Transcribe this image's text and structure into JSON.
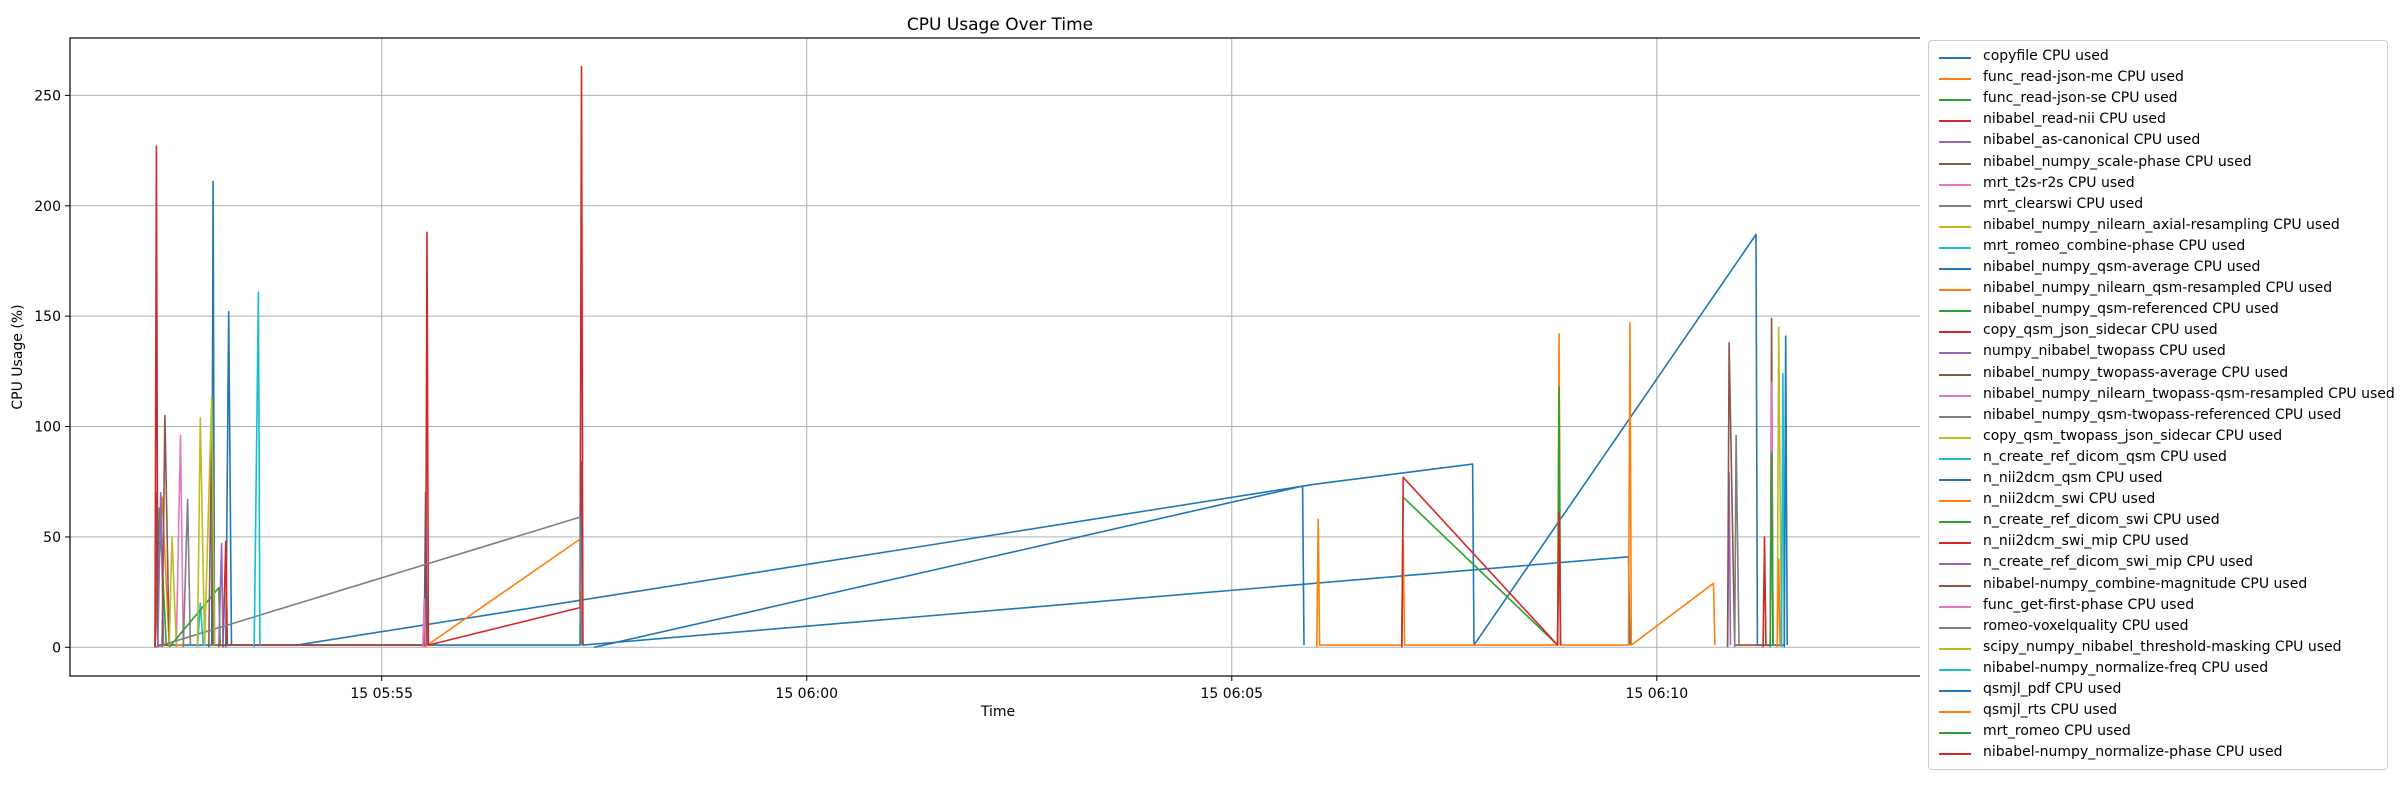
{
  "palette": [
    "#1f77b4",
    "#ff7f0e",
    "#2ca02c",
    "#d62728",
    "#9467bd",
    "#8c564b",
    "#e377c2",
    "#7f7f7f",
    "#bcbd22",
    "#17becf"
  ],
  "chart_data": {
    "type": "line",
    "title": "CPU Usage Over Time",
    "xlabel": "Time",
    "ylabel": "CPU Usage (%)",
    "xlim": [
      "05:51:20",
      "06:13:10"
    ],
    "ylim": [
      -13,
      276
    ],
    "x_ticks": [
      "15 05:55",
      "15 06:00",
      "15 06:05",
      "15 06:10"
    ],
    "y_ticks": [
      "0",
      "50",
      "100",
      "150",
      "200",
      "250"
    ],
    "grid": true,
    "legend_position": "outside-right",
    "series": [
      {
        "name": "copyfile CPU used",
        "points": [
          [
            "05:52:20",
            0
          ],
          [
            "05:52:21",
            70
          ],
          [
            "05:52:22",
            1
          ],
          [
            "05:53:00",
            1
          ],
          [
            "05:53:01",
            211
          ],
          [
            "05:53:02",
            1
          ],
          [
            "05:54:00",
            1
          ],
          [
            "06:06:00",
            74
          ],
          [
            "06:07:50",
            83
          ],
          [
            "06:07:51",
            1
          ],
          [
            "06:11:10",
            187
          ],
          [
            "06:11:11",
            1
          ],
          [
            "06:11:30",
            1
          ]
        ]
      },
      {
        "name": "func_read-json-me CPU used",
        "points": [
          [
            "05:52:20",
            0
          ],
          [
            "05:52:25",
            68
          ],
          [
            "05:52:30",
            1
          ],
          [
            "05:52:40",
            1
          ]
        ]
      },
      {
        "name": "func_read-json-se CPU used",
        "points": [
          [
            "05:52:20",
            0
          ],
          [
            "05:52:23",
            63
          ],
          [
            "05:52:28",
            1
          ],
          [
            "05:52:35",
            1
          ]
        ]
      },
      {
        "name": "nibabel_read-nii CPU used",
        "points": [
          [
            "05:52:20",
            0
          ],
          [
            "05:52:21",
            227
          ],
          [
            "05:52:22",
            1
          ],
          [
            "05:52:30",
            1
          ]
        ]
      },
      {
        "name": "nibabel_as-canonical CPU used",
        "points": [
          [
            "05:52:22",
            0
          ],
          [
            "05:52:24",
            70
          ],
          [
            "05:52:26",
            1
          ]
        ]
      },
      {
        "name": "nibabel_numpy_scale-phase CPU used",
        "points": [
          [
            "05:52:25",
            0
          ],
          [
            "05:52:27",
            105
          ],
          [
            "05:52:30",
            1
          ]
        ]
      },
      {
        "name": "mrt_t2s-r2s CPU used",
        "points": [
          [
            "05:52:35",
            0
          ],
          [
            "05:52:38",
            96
          ],
          [
            "05:52:40",
            1
          ]
        ]
      },
      {
        "name": "mrt_clearswi CPU used",
        "points": [
          [
            "05:52:40",
            0
          ],
          [
            "05:52:43",
            67
          ],
          [
            "05:52:45",
            1
          ]
        ]
      },
      {
        "name": "nibabel_numpy_nilearn_axial-resampling CPU used",
        "points": [
          [
            "05:52:30",
            0
          ],
          [
            "05:52:32",
            50
          ],
          [
            "05:52:35",
            1
          ]
        ]
      },
      {
        "name": "mrt_romeo_combine-phase CPU used",
        "points": [
          [
            "05:52:50",
            0
          ],
          [
            "05:52:52",
            20
          ],
          [
            "05:52:54",
            1
          ]
        ]
      },
      {
        "name": "nibabel_numpy_qsm-average CPU used",
        "points": [
          [
            "05:53:10",
            0
          ],
          [
            "05:53:12",
            152
          ],
          [
            "05:53:14",
            1
          ],
          [
            "05:55:30",
            1
          ],
          [
            "05:55:31",
            70
          ],
          [
            "05:55:32",
            1
          ],
          [
            "05:57:20",
            1
          ],
          [
            "05:57:21",
            84
          ],
          [
            "05:57:22",
            1
          ],
          [
            "06:09:40",
            41
          ],
          [
            "06:09:41",
            1
          ]
        ]
      },
      {
        "name": "nibabel_numpy_nilearn_qsm-resampled CPU used",
        "points": [
          [
            "05:55:30",
            0
          ],
          [
            "05:57:20",
            49
          ],
          [
            "05:57:21",
            1
          ]
        ]
      },
      {
        "name": "nibabel_numpy_qsm-referenced CPU used",
        "points": [
          [
            "05:52:30",
            0
          ],
          [
            "05:53:05",
            27
          ],
          [
            "05:53:06",
            1
          ]
        ]
      },
      {
        "name": "copy_qsm_json_sidecar CPU used",
        "points": [
          [
            "05:53:08",
            0
          ],
          [
            "05:53:10",
            48
          ],
          [
            "05:53:11",
            1
          ],
          [
            "05:55:31",
            1
          ],
          [
            "05:55:32",
            188
          ],
          [
            "05:55:33",
            1
          ],
          [
            "05:57:20",
            18
          ],
          [
            "05:57:21",
            263
          ],
          [
            "05:57:22",
            1
          ]
        ]
      },
      {
        "name": "numpy_nibabel_twopass CPU used",
        "points": [
          [
            "05:53:05",
            0
          ],
          [
            "05:53:07",
            47
          ],
          [
            "05:53:08",
            1
          ]
        ]
      },
      {
        "name": "nibabel_numpy_twopass-average CPU used",
        "points": [
          [
            "05:52:58",
            0
          ],
          [
            "05:53:00",
            102
          ],
          [
            "05:53:01",
            1
          ],
          [
            "05:55:30",
            1
          ],
          [
            "05:55:31",
            24
          ],
          [
            "05:55:32",
            1
          ]
        ]
      },
      {
        "name": "nibabel_numpy_nilearn_twopass-qsm-resampled CPU used",
        "points": [
          [
            "05:55:29",
            0
          ],
          [
            "05:55:30",
            22
          ],
          [
            "05:55:31",
            1
          ]
        ]
      },
      {
        "name": "nibabel_numpy_qsm-twopass-referenced CPU used",
        "points": [
          [
            "05:52:20",
            0
          ],
          [
            "05:57:20",
            59
          ],
          [
            "05:57:21",
            1
          ]
        ]
      },
      {
        "name": "copy_qsm_twopass_json_sidecar CPU used",
        "points": [
          [
            "05:52:50",
            0
          ],
          [
            "05:52:52",
            104
          ],
          [
            "05:52:55",
            1
          ],
          [
            "05:53:00",
            113
          ],
          [
            "05:53:02",
            1
          ]
        ]
      },
      {
        "name": "n_create_ref_dicom_qsm CPU used",
        "points": [
          [
            "05:53:30",
            0
          ],
          [
            "05:53:33",
            161
          ],
          [
            "05:53:34",
            1
          ]
        ]
      },
      {
        "name": "n_nii2dcm_qsm CPU used",
        "points": [
          [
            "05:57:30",
            0
          ],
          [
            "06:05:50",
            73
          ],
          [
            "06:05:51",
            1
          ]
        ]
      },
      {
        "name": "n_nii2dcm_swi CPU used",
        "points": [
          [
            "06:06:00",
            0
          ],
          [
            "06:06:01",
            58
          ],
          [
            "06:06:02",
            1
          ],
          [
            "06:07:00",
            1
          ],
          [
            "06:07:01",
            48
          ],
          [
            "06:07:02",
            1
          ],
          [
            "06:08:50",
            1
          ],
          [
            "06:08:51",
            142
          ],
          [
            "06:08:52",
            1
          ],
          [
            "06:09:40",
            1
          ],
          [
            "06:09:41",
            147
          ],
          [
            "06:09:42",
            1
          ],
          [
            "06:10:40",
            29
          ],
          [
            "06:10:41",
            1
          ]
        ]
      },
      {
        "name": "n_create_ref_dicom_swi CPU used",
        "points": [
          [
            "06:07:00",
            0
          ],
          [
            "06:07:01",
            68
          ],
          [
            "06:08:50",
            1
          ],
          [
            "06:08:51",
            118
          ],
          [
            "06:08:52",
            1
          ]
        ]
      },
      {
        "name": "n_nii2dcm_swi_mip CPU used",
        "points": [
          [
            "06:07:00",
            0
          ],
          [
            "06:07:01",
            77
          ],
          [
            "06:08:50",
            1
          ],
          [
            "06:08:51",
            61
          ],
          [
            "06:08:52",
            1
          ]
        ]
      },
      {
        "name": "n_create_ref_dicom_swi_mip CPU used",
        "points": [
          [
            "06:10:50",
            0
          ],
          [
            "06:10:51",
            79
          ],
          [
            "06:10:52",
            1
          ]
        ]
      },
      {
        "name": "nibabel-numpy_combine-magnitude CPU used",
        "points": [
          [
            "06:10:50",
            0
          ],
          [
            "06:10:51",
            138
          ],
          [
            "06:10:55",
            1
          ],
          [
            "06:11:20",
            1
          ],
          [
            "06:11:21",
            149
          ],
          [
            "06:11:22",
            1
          ]
        ]
      },
      {
        "name": "func_get-first-phase CPU used",
        "points": [
          [
            "06:11:20",
            0
          ],
          [
            "06:11:21",
            120
          ],
          [
            "06:11:22",
            1
          ]
        ]
      },
      {
        "name": "romeo-voxelquality CPU used",
        "points": [
          [
            "06:10:55",
            0
          ],
          [
            "06:10:56",
            96
          ],
          [
            "06:10:58",
            1
          ]
        ]
      },
      {
        "name": "scipy_numpy_nibabel_threshold-masking CPU used",
        "points": [
          [
            "06:11:25",
            0
          ],
          [
            "06:11:26",
            145
          ],
          [
            "06:11:28",
            1
          ]
        ]
      },
      {
        "name": "nibabel-numpy_normalize-freq CPU used",
        "points": [
          [
            "06:11:28",
            0
          ],
          [
            "06:11:29",
            124
          ],
          [
            "06:11:30",
            1
          ]
        ]
      },
      {
        "name": "qsmjl_pdf CPU used",
        "points": [
          [
            "06:11:30",
            0
          ],
          [
            "06:11:31",
            141
          ],
          [
            "06:11:32",
            1
          ]
        ]
      },
      {
        "name": "qsmjl_rts CPU used",
        "points": [
          [
            "06:11:25",
            0
          ],
          [
            "06:11:26",
            40
          ],
          [
            "06:11:27",
            1
          ]
        ]
      },
      {
        "name": "mrt_romeo CPU used",
        "points": [
          [
            "06:11:20",
            0
          ],
          [
            "06:11:21",
            88
          ],
          [
            "06:11:22",
            1
          ]
        ]
      },
      {
        "name": "nibabel-numpy_normalize-phase CPU used",
        "points": [
          [
            "06:11:15",
            0
          ],
          [
            "06:11:16",
            50
          ],
          [
            "06:11:17",
            1
          ]
        ]
      }
    ]
  }
}
